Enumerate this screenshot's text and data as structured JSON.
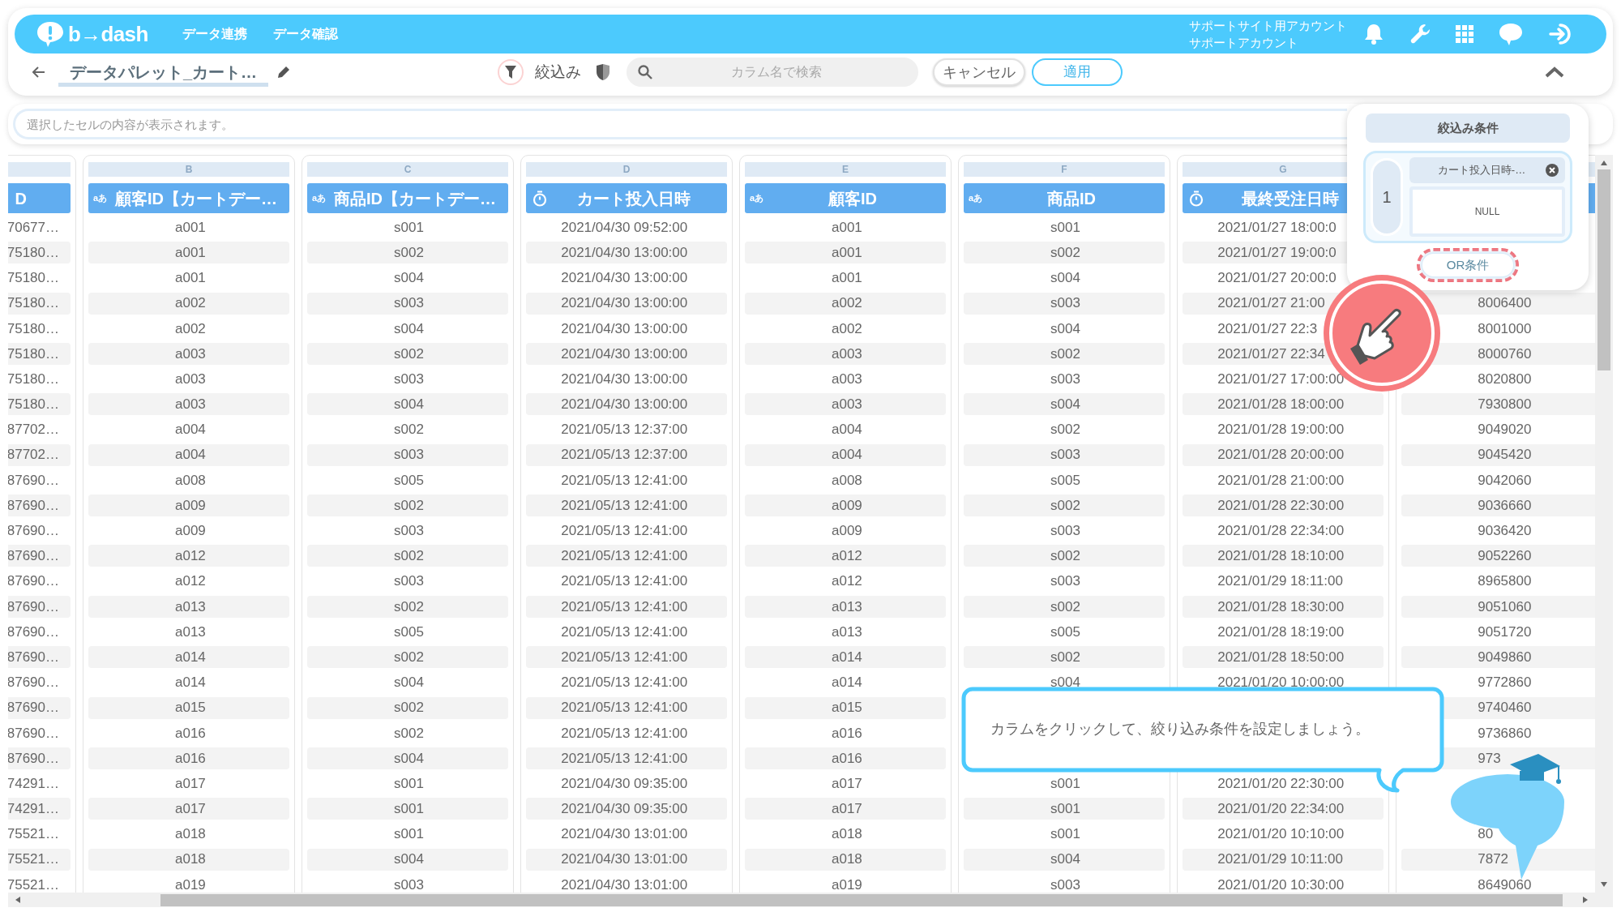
{
  "header": {
    "logo": "b→dash",
    "nav": [
      "データ連携",
      "データ確認"
    ],
    "account": [
      "サポートサイト用アカウント",
      "サポートアカウント"
    ]
  },
  "toolbar": {
    "title": "データパレット_カート…",
    "filter_label": "絞込み",
    "search": {
      "placeholder": "カラム名で検索"
    },
    "buttons": [
      {
        "label": "キャンセル",
        "kind": "secondary"
      },
      {
        "label": "適用",
        "kind": "primary"
      }
    ]
  },
  "cell_preview": {
    "placeholder": "選択したセルの内容が表示されます。"
  },
  "columns": [
    {
      "title": "D",
      "cells": [
        "70677…",
        "75180…",
        "75180…",
        "75180…",
        "75180…",
        "75180…",
        "75180…",
        "75180…",
        "87702…",
        "87702…",
        "87690…",
        "87690…",
        "87690…",
        "87690…",
        "87690…",
        "87690…",
        "87690…",
        "87690…",
        "87690…",
        "87690…",
        "87690…",
        "87690…",
        "74291…",
        "74291…",
        "75521…",
        "75521…",
        "75521…"
      ]
    },
    {
      "letter": "B",
      "kind": "text",
      "type_mark": "aあ",
      "title": "顧客ID【カートデー…",
      "cells": [
        "a001",
        "a001",
        "a001",
        "a002",
        "a002",
        "a003",
        "a003",
        "a003",
        "a004",
        "a004",
        "a008",
        "a009",
        "a009",
        "a012",
        "a012",
        "a013",
        "a013",
        "a014",
        "a014",
        "a015",
        "a016",
        "a016",
        "a017",
        "a017",
        "a018",
        "a018",
        "a019"
      ]
    },
    {
      "letter": "C",
      "kind": "text",
      "type_mark": "aあ",
      "title": "商品ID【カートデー…",
      "cells": [
        "s001",
        "s002",
        "s004",
        "s003",
        "s004",
        "s002",
        "s003",
        "s004",
        "s002",
        "s003",
        "s005",
        "s002",
        "s003",
        "s002",
        "s003",
        "s002",
        "s005",
        "s002",
        "s004",
        "s002",
        "s002",
        "s004",
        "s001",
        "s001",
        "s001",
        "s004",
        "s003"
      ]
    },
    {
      "letter": "D",
      "kind": "datetime",
      "title": "カート投入日時",
      "cells": [
        "2021/04/30 09:52:00",
        "2021/04/30 13:00:00",
        "2021/04/30 13:00:00",
        "2021/04/30 13:00:00",
        "2021/04/30 13:00:00",
        "2021/04/30 13:00:00",
        "2021/04/30 13:00:00",
        "2021/04/30 13:00:00",
        "2021/05/13 12:37:00",
        "2021/05/13 12:37:00",
        "2021/05/13 12:41:00",
        "2021/05/13 12:41:00",
        "2021/05/13 12:41:00",
        "2021/05/13 12:41:00",
        "2021/05/13 12:41:00",
        "2021/05/13 12:41:00",
        "2021/05/13 12:41:00",
        "2021/05/13 12:41:00",
        "2021/05/13 12:41:00",
        "2021/05/13 12:41:00",
        "2021/05/13 12:41:00",
        "2021/05/13 12:41:00",
        "2021/04/30 09:35:00",
        "2021/04/30 09:35:00",
        "2021/04/30 13:01:00",
        "2021/04/30 13:01:00",
        "2021/04/30 13:01:00"
      ]
    },
    {
      "letter": "E",
      "kind": "text",
      "type_mark": "aあ",
      "title": "顧客ID",
      "cells": [
        "a001",
        "a001",
        "a001",
        "a002",
        "a002",
        "a003",
        "a003",
        "a003",
        "a004",
        "a004",
        "a008",
        "a009",
        "a009",
        "a012",
        "a012",
        "a013",
        "a013",
        "a014",
        "a014",
        "a015",
        "a016",
        "a016",
        "a017",
        "a017",
        "a018",
        "a018",
        "a019"
      ]
    },
    {
      "letter": "F",
      "kind": "text",
      "type_mark": "aあ",
      "title": "商品ID",
      "cells": [
        "s001",
        "s002",
        "s004",
        "s003",
        "s004",
        "s002",
        "s003",
        "s004",
        "s002",
        "s003",
        "s005",
        "s002",
        "s003",
        "s002",
        "s003",
        "s002",
        "s005",
        "s002",
        "s004",
        null,
        null,
        null,
        "s001",
        "s001",
        "s001",
        "s004",
        "s003"
      ]
    },
    {
      "letter": "G",
      "kind": "datetime",
      "title": "最終受注日時",
      "cells": [
        "2021/01/27 18:00:0",
        "2021/01/27 19:00:0",
        "2021/01/27 20:00:0",
        "2021/01/27 21:00",
        "2021/01/27 22:3",
        "2021/01/27 22:34",
        "2021/01/27 17:00:00",
        "2021/01/28 18:00:00",
        "2021/01/28 19:00:00",
        "2021/01/28 20:00:00",
        "2021/01/28 21:00:00",
        "2021/01/28 22:30:00",
        "2021/01/28 22:34:00",
        "2021/01/28 18:10:00",
        "2021/01/29 18:11:00",
        "2021/01/28 18:30:00",
        "2021/01/28 18:19:00",
        "2021/01/28 18:50:00",
        "2021/01/20 10:00:00",
        null,
        null,
        null,
        "2021/01/20 22:30:00",
        "2021/01/20 22:34:00",
        "2021/01/20 10:10:00",
        "2021/01/29 10:11:00",
        "2021/01/20 10:30:00"
      ]
    },
    {
      "cells": [
        null,
        null,
        null,
        "8006400",
        "8001000",
        "8000760",
        "8020800",
        "7930800",
        "9049020",
        "9045420",
        "9042060",
        "9036660",
        "9036420",
        "9052260",
        "8965800",
        "9051060",
        "9051720",
        "9049860",
        "9772860",
        "9740460",
        "9736860",
        "973",
        null,
        null,
        "80",
        "7872",
        "8649060"
      ]
    }
  ],
  "filter_panel": {
    "title": "絞込み条件",
    "conditions": [
      {
        "number": "1",
        "chip": "カート投入日時-…",
        "value": "NULL"
      }
    ],
    "or_button": "OR条件"
  },
  "guide": {
    "message": "カラムをクリックして、絞り込み条件を設定しましょう。"
  }
}
